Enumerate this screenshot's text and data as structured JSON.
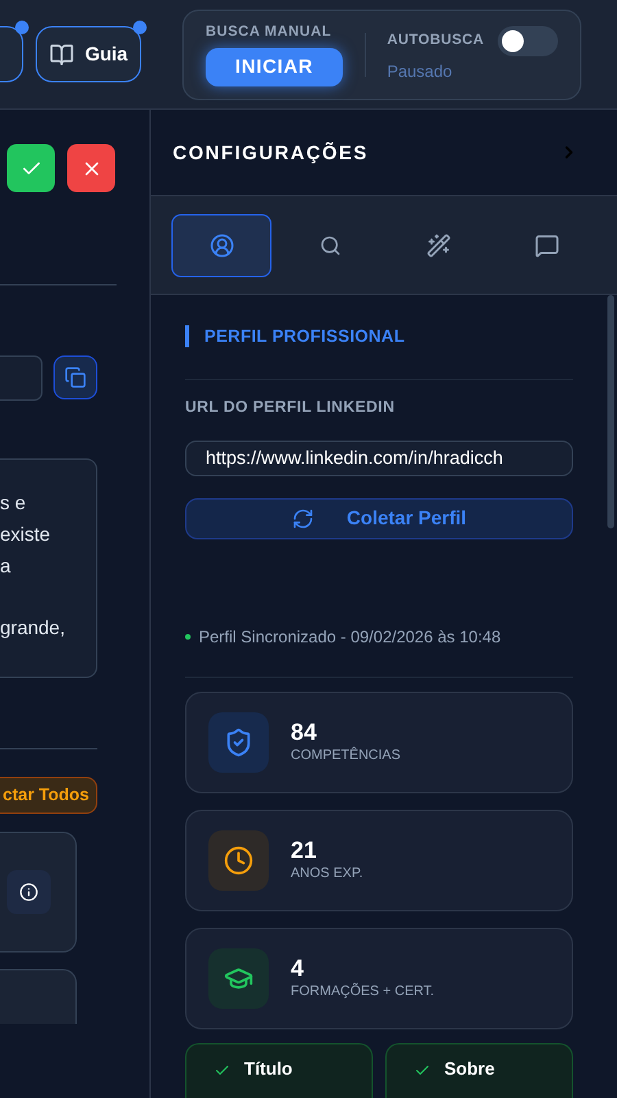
{
  "toolbar": {
    "buttons": [
      {
        "kind": "plain",
        "notification_dot": true
      },
      {
        "kind": "guide",
        "label": "Guia",
        "notification_dot": true
      }
    ]
  },
  "manual_search": {
    "label": "BUSCA MANUAL",
    "button": "INICIAR"
  },
  "autosearch": {
    "label": "AUTOBUSCA",
    "on": false,
    "status": "Pausado"
  },
  "left_panel": {
    "paragraphs": [
      "s e\nexiste\na",
      "grande,"
    ],
    "select_all_button": "ctar Todos"
  },
  "settings": {
    "title": "CONFIGURAÇÕES",
    "tabs": [
      {
        "kind": "profile",
        "selected": true
      },
      {
        "kind": "search",
        "selected": false
      },
      {
        "kind": "magic",
        "selected": false
      },
      {
        "kind": "chat",
        "selected": false
      }
    ],
    "section_title": "PERFIL PROFISSIONAL",
    "url_label": "URL DO PERFIL LINKEDIN",
    "url_value": "https://www.linkedin.com/in/hradicch",
    "collect_button": "Coletar Perfil",
    "sync_status": {
      "text": "Perfil Sincronizado - 09/02/2026 às 10:48",
      "color": "#22c55e"
    },
    "stats": [
      {
        "kind": "skills",
        "value": "84",
        "label": "COMPETÊNCIAS"
      },
      {
        "kind": "experience",
        "value": "21",
        "label": "ANOS EXP."
      },
      {
        "kind": "education",
        "value": "4",
        "label": "FORMAÇÕES + CERT."
      }
    ],
    "checks": [
      {
        "label": "Título",
        "checked": true
      },
      {
        "label": "Sobre",
        "checked": true
      }
    ]
  }
}
